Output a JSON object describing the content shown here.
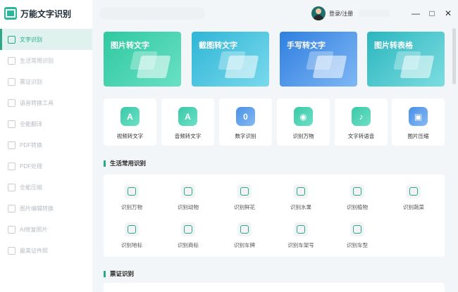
{
  "app": {
    "title": "万能文字识别"
  },
  "user": {
    "login_label": "登录/注册"
  },
  "window": {
    "minimize": "—",
    "maximize": "□",
    "close": "✕"
  },
  "sidebar": {
    "items": [
      {
        "label": "文字识别",
        "active": true
      },
      {
        "label": "生活常用识别"
      },
      {
        "label": "票证识别"
      },
      {
        "label": "语音转换工具"
      },
      {
        "label": "全能翻译"
      },
      {
        "label": "PDF转换"
      },
      {
        "label": "PDF处理"
      },
      {
        "label": "全能压缩"
      },
      {
        "label": "图片编辑转换"
      },
      {
        "label": "AI修复照片"
      },
      {
        "label": "最美证件照"
      }
    ]
  },
  "features": [
    {
      "label": "图片转文字"
    },
    {
      "label": "截图转文字"
    },
    {
      "label": "手写转文字"
    },
    {
      "label": "图片转表格"
    }
  ],
  "tools": [
    {
      "label": "视频转文字",
      "icon": "A"
    },
    {
      "label": "音频转文字",
      "icon": "A"
    },
    {
      "label": "数字识别",
      "icon": "0"
    },
    {
      "label": "识别万物",
      "icon": "◉"
    },
    {
      "label": "文字转语音",
      "icon": "♪"
    },
    {
      "label": "图片压缩",
      "icon": "▣"
    }
  ],
  "sections": {
    "life": {
      "title": "生活常用识别",
      "items": [
        "识别万物",
        "识别动物",
        "识别鲜花",
        "识别水果",
        "识别植物",
        "识别蔬菜",
        "识别地标",
        "识别商标",
        "识别车牌",
        "识别车架号",
        "识别车型"
      ]
    },
    "ticket": {
      "title": "票证识别"
    }
  }
}
